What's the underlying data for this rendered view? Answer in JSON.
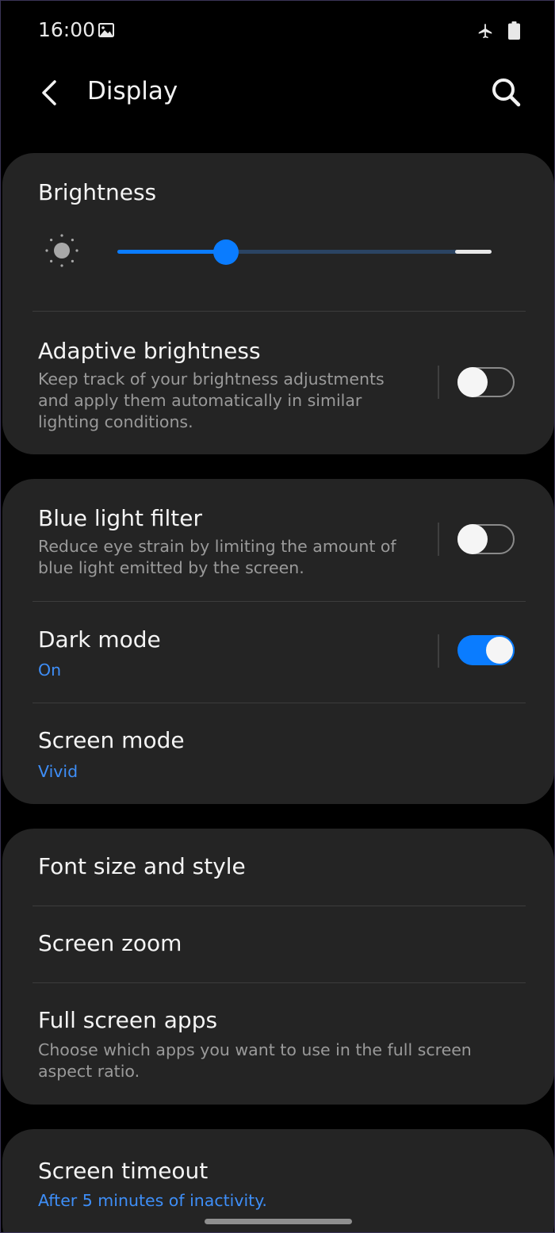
{
  "status_bar": {
    "time": "16:00",
    "icons": [
      "image-icon",
      "airplane-icon",
      "battery-icon"
    ]
  },
  "header": {
    "title": "Display",
    "back_icon": "back-arrow-icon",
    "search_icon": "search-icon"
  },
  "brightness_card": {
    "brightness_title": "Brightness",
    "brightness_level": 0.29,
    "adaptive": {
      "title": "Adaptive brightness",
      "subtitle": "Keep track of your brightness adjustments and apply them automatically in similar lighting conditions.",
      "enabled": false
    }
  },
  "display_card": {
    "blue_light": {
      "title": "Blue light filter",
      "subtitle": "Reduce eye strain by limiting the amount of blue light emitted by the screen.",
      "enabled": false
    },
    "dark_mode": {
      "title": "Dark mode",
      "value": "On",
      "enabled": true
    },
    "screen_mode": {
      "title": "Screen mode",
      "value": "Vivid"
    }
  },
  "font_card": {
    "font_size": {
      "title": "Font size and style"
    },
    "screen_zoom": {
      "title": "Screen zoom"
    },
    "full_screen_apps": {
      "title": "Full screen apps",
      "subtitle": "Choose which apps you want to use in the full screen aspect ratio."
    }
  },
  "timeout_card": {
    "screen_timeout": {
      "title": "Screen timeout",
      "value": "After 5 minutes of inactivity."
    }
  },
  "colors": {
    "accent": "#0a7cff",
    "value_text": "#3e8ef7",
    "card_bg": "#242424",
    "background": "#000000"
  }
}
